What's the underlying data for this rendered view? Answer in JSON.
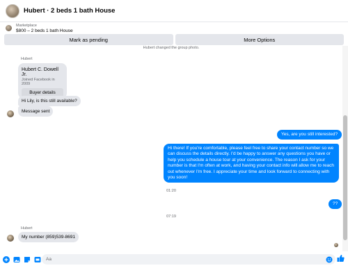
{
  "header": {
    "title": "Hubert · 2 beds 1 bath House"
  },
  "marketplace": {
    "label": "Marketplace",
    "title": "$800 – 2 beds 1 bath House"
  },
  "actions": {
    "pending": "Mark as pending",
    "more": "More Options"
  },
  "thread": {
    "system_text": "Hubert changed the group photo.",
    "sender_name_1": "Hubert",
    "card": {
      "title": "Hubert C. Dowell Jr.",
      "subtitle": "Joined Facebook in 2009",
      "button": "Buyer details"
    },
    "msg_available": "Hi Lily, is this still available?",
    "msg_sent": "Message sent",
    "out_1": "Yes, are you still interested?",
    "out_2": "Hi there! If you're comfortable, please feel free to share your contact number so we can discuss the details directly. I'd be happy to answer any questions you have or help you schedule a house tour at your convenience. The reason I ask for your number is that I'm often at work, and having your contact info will allow me to reach out whenever I'm free. I appreciate your time and look forward to connecting with you soon!",
    "time_1": "01:20",
    "out_3": "??",
    "time_2": "07:19",
    "sender_name_2": "Hubert",
    "msg_number": "My number (859)539-8691"
  },
  "composer": {
    "placeholder": "Aa"
  },
  "colors": {
    "accent": "#0084ff",
    "bubble_in": "#e4e6eb"
  },
  "icons": [
    "plus-circle-icon",
    "image-icon",
    "sticker-icon",
    "gif-icon",
    "emoji-icon",
    "thumbs-up-icon"
  ]
}
